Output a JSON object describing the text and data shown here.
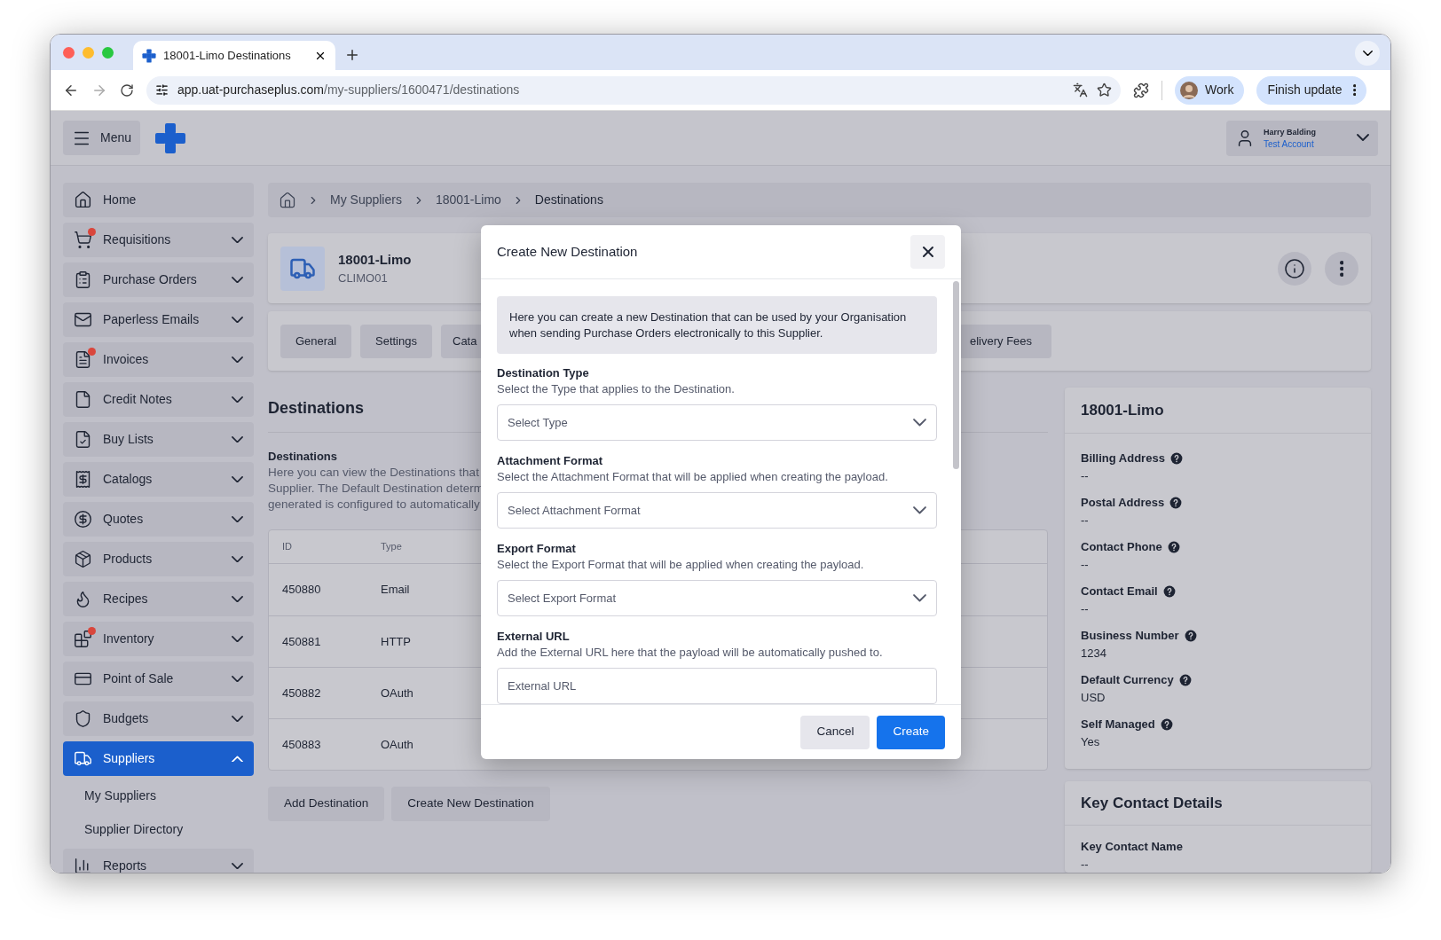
{
  "browser": {
    "tab_title": "18001-Limo Destinations",
    "url_host": "app.uat-purchaseplus.com",
    "url_path": "/my-suppliers/1600471/destinations",
    "profile": "Work",
    "update_button": "Finish update"
  },
  "app_header": {
    "menu_label": "Menu",
    "user_name": "Harry Balding",
    "account": "Test Account"
  },
  "sidebar": {
    "items": [
      {
        "label": "Home",
        "kind": "link",
        "badge": false,
        "selected": false
      },
      {
        "label": "Requisitions",
        "kind": "group",
        "badge": true,
        "expanded": false,
        "selected": false
      },
      {
        "label": "Purchase Orders",
        "kind": "group",
        "badge": false,
        "expanded": false,
        "selected": false
      },
      {
        "label": "Paperless Emails",
        "kind": "group",
        "badge": false,
        "expanded": false,
        "selected": false
      },
      {
        "label": "Invoices",
        "kind": "group",
        "badge": true,
        "expanded": false,
        "selected": false
      },
      {
        "label": "Credit Notes",
        "kind": "group",
        "badge": false,
        "expanded": false,
        "selected": false
      },
      {
        "label": "Buy Lists",
        "kind": "group",
        "badge": false,
        "expanded": false,
        "selected": false
      },
      {
        "label": "Catalogs",
        "kind": "group",
        "badge": false,
        "expanded": false,
        "selected": false
      },
      {
        "label": "Quotes",
        "kind": "group",
        "badge": false,
        "expanded": false,
        "selected": false
      },
      {
        "label": "Products",
        "kind": "group",
        "badge": false,
        "expanded": false,
        "selected": false
      },
      {
        "label": "Recipes",
        "kind": "group",
        "badge": false,
        "expanded": false,
        "selected": false
      },
      {
        "label": "Inventory",
        "kind": "group",
        "badge": true,
        "expanded": false,
        "selected": false
      },
      {
        "label": "Point of Sale",
        "kind": "group",
        "badge": false,
        "expanded": false,
        "selected": false
      },
      {
        "label": "Budgets",
        "kind": "group",
        "badge": false,
        "expanded": false,
        "selected": false
      },
      {
        "label": "Suppliers",
        "kind": "group",
        "badge": false,
        "expanded": true,
        "selected": true,
        "children": [
          {
            "label": "My Suppliers",
            "selected": false
          },
          {
            "label": "Supplier Directory",
            "selected": false
          }
        ]
      },
      {
        "label": "Reports",
        "kind": "group",
        "badge": false,
        "expanded": false,
        "selected": false
      }
    ]
  },
  "breadcrumb": [
    "My Suppliers",
    "18001-Limo",
    "Destinations"
  ],
  "supplier": {
    "name": "18001-Limo",
    "code": "CLIMO01"
  },
  "tabs": [
    {
      "label": "General",
      "selected": false
    },
    {
      "label": "Settings",
      "selected": false
    },
    {
      "label": "Cata",
      "selected": false
    },
    {
      "label": "elivery Fees",
      "selected": false
    }
  ],
  "section": {
    "title": "Destinations",
    "subtitle": "Destinations",
    "description_lines": [
      "Here you can view the Destinations that",
      "Supplier. The Default Destination determ",
      "generated is configured to automatically"
    ]
  },
  "table": {
    "columns": [
      "ID",
      "Type"
    ],
    "rows": [
      [
        "450880",
        "Email"
      ],
      [
        "450881",
        "HTTP"
      ],
      [
        "450882",
        "OAuth"
      ],
      [
        "450883",
        "OAuth"
      ]
    ]
  },
  "actions": [
    "Add Destination",
    "Create New Destination"
  ],
  "details": {
    "title": "18001-Limo",
    "fields": [
      {
        "label": "Billing Address",
        "value": "--"
      },
      {
        "label": "Postal Address",
        "value": "--"
      },
      {
        "label": "Contact Phone",
        "value": "--"
      },
      {
        "label": "Contact Email",
        "value": "--"
      },
      {
        "label": "Business Number",
        "value": "1234"
      },
      {
        "label": "Default Currency",
        "value": "USD"
      },
      {
        "label": "Self Managed",
        "value": "Yes"
      }
    ]
  },
  "key_contact": {
    "title": "Key Contact Details",
    "fields": [
      {
        "label": "Key Contact Name",
        "value": "--"
      }
    ]
  },
  "modal": {
    "title": "Create New Destination",
    "intro": "Here you can create a new Destination that can be used by your Organisation when sending Purchase Orders electronically to this Supplier.",
    "fields": [
      {
        "kind": "select",
        "label": "Destination Type",
        "help": "Select the Type that applies to the Destination.",
        "placeholder": "Select Type"
      },
      {
        "kind": "select",
        "label": "Attachment Format",
        "help": "Select the Attachment Format that will be applied when creating the payload.",
        "placeholder": "Select Attachment Format"
      },
      {
        "kind": "select",
        "label": "Export Format",
        "help": "Select the Export Format that will be applied when creating the payload.",
        "placeholder": "Select Export Format"
      },
      {
        "kind": "text",
        "label": "External URL",
        "help": "Add the External URL here that the payload will be automatically pushed to.",
        "placeholder": "External URL"
      }
    ],
    "buttons": [
      {
        "label": "Cancel",
        "kind": "secondary"
      },
      {
        "label": "Create",
        "kind": "primary"
      }
    ]
  }
}
